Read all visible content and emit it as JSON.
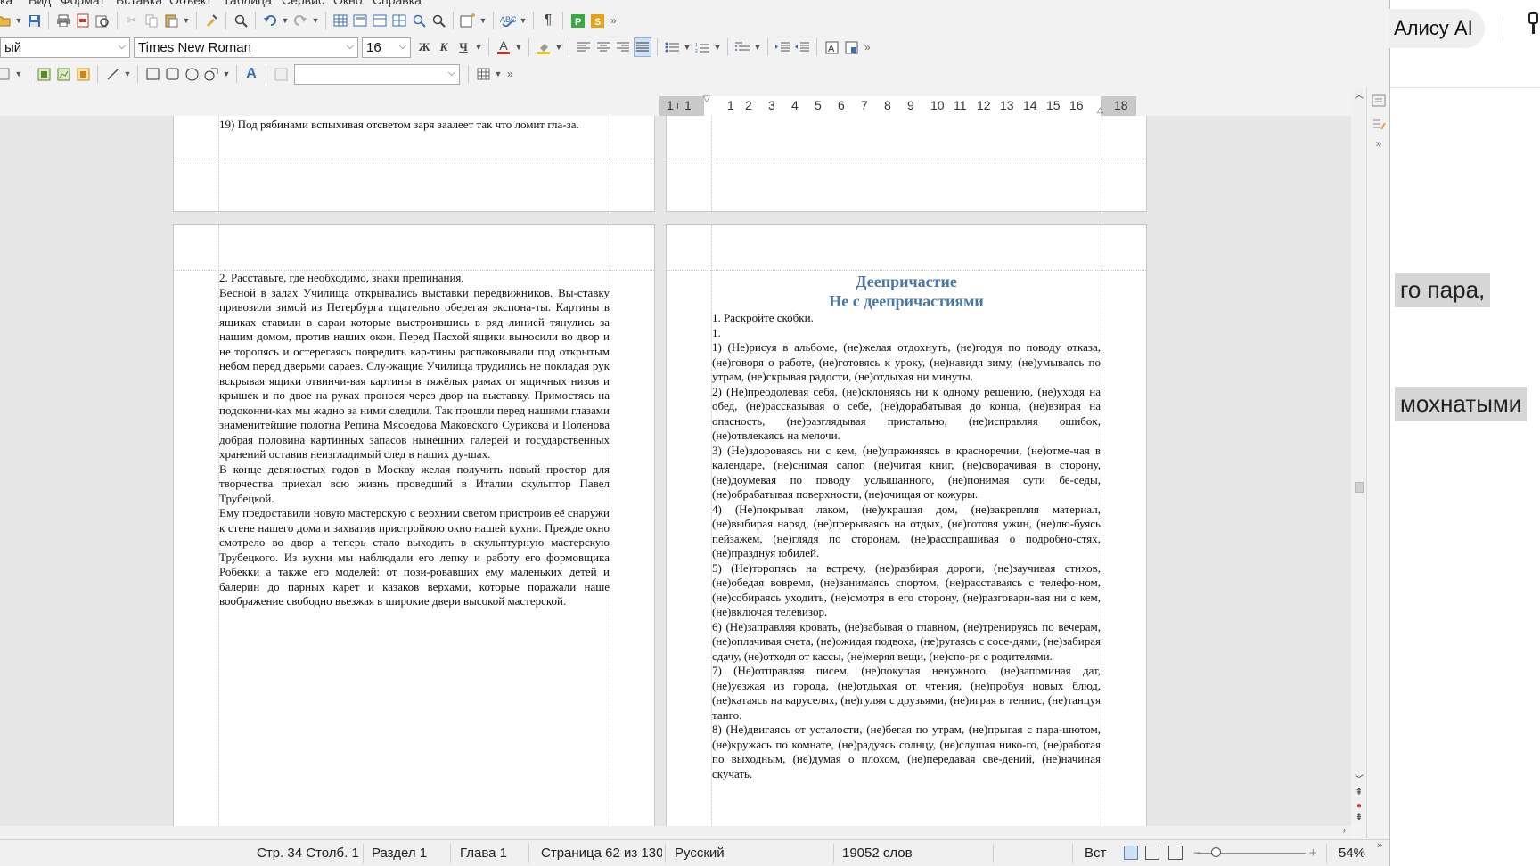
{
  "menu": [
    "ка",
    "Вид",
    "Формат",
    "Вставка",
    "Объект",
    "Таблица",
    "Сервис",
    "Окно",
    "Справка"
  ],
  "toolbar2": {
    "paragraph_style": "ый",
    "font_name": "Times New Roman",
    "font_size": "16",
    "bold_label": "Ж",
    "italic_label": "К",
    "underline_label": "Ч",
    "font_color_label": "A"
  },
  "ruler": {
    "numbers": [
      "1",
      "1",
      "1",
      "2",
      "3",
      "4",
      "5",
      "6",
      "7",
      "8",
      "9",
      "10",
      "11",
      "12",
      "13",
      "14",
      "15",
      "16",
      "18"
    ]
  },
  "pages": {
    "top_left_text": "19) Под рябинами вспыхивая отсветом заря заалеет так что ломит гла-за.",
    "left_paragraphs": [
      "2. Расставьте, где необходимо, знаки препинания.",
      "Весной в залах Училища открывались выставки передвижников. Вы-ставку привозили зимой из Петербурга тщательно оберегая экспона-ты. Картины в ящиках ставили в сараи которые выстроившись в ряд линией тянулись за нашим домом, против наших окон. Перед Пасхой ящики выносили во двор и не торопясь и остерегаясь повредить кар-тины распаковывали под открытым небом перед дверьми сараев. Слу-жащие Училища трудились не покладая рук вскрывая ящики отвинчи-вая картины в тяжёлых рамах от ящичных низов и крышек и по двое на руках пронося через двор на выставку. Примостясь на подоконни-ках мы жадно за ними следили. Так прошли перед нашими глазами знаменитейшие полотна Репина Мясоедова Маковского Сурикова и Поленова добрая половина картинных запасов нынешних галерей и государственных хранений оставив неизгладимый след в наших ду-шах.",
      "В конце девяностых годов в Москву желая получить новый простор для творчества приехал всю жизнь проведший в Италии скульптор Павел Трубецкой.",
      "Ему предоставили новую мастерскую с верхним светом пристроив её снаружи к стене нашего дома и захватив пристройкою окно нашей кухни. Прежде окно смотрело во двор а теперь стало выходить в скульптурную мастерскую Трубецкого. Из кухни мы наблюдали его лепку и работу его формовщика Робекки а также его моделей: от пози-ровавших ему маленьких детей и балерин до парных карет и казаков верхами, которые поражали наше воображение свободно въезжая в широкие двери высокой мастерской."
    ],
    "right_heading_1": "Деепричастие",
    "right_heading_2": "Не с деепричастиями",
    "right_paragraphs": [
      "1. Раскройте скобки.",
      "1.",
      "1) (Не)рисуя в альбоме, (не)желая отдохнуть, (не)годуя по поводу отказа, (не)говоря о работе, (не)готовясь к уроку, (не)навидя зиму, (не)умываясь по утрам, (не)скрывая радости, (не)отдыхая ни минуты.",
      "2) (Не)преодолевая себя, (не)склоняясь ни к одному решению, (не)уходя на обед, (не)рассказывая о себе, (не)дорабатывая до конца, (не)взирая на опасность, (не)разглядывая пристально, (не)исправляя ошибок, (не)отвлекаясь на мелочи.",
      "3) (Не)здороваясь ни с кем, (не)упражняясь в красноречии, (не)отме-чая в календаре, (не)снимая сапог, (не)читая книг, (не)сворачивая в сторону, (не)доумевая по поводу услышанного, (не)понимая сути бе-седы, (не)обрабатывая поверхности, (не)очищая от кожуры.",
      "4) (Не)покрывая лаком, (не)украшая дом, (не)закрепляя материал, (не)выбирая наряд, (не)прерываясь на отдых, (не)готовя ужин, (не)лю-буясь пейзажем, (не)глядя по сторонам, (не)расспрашивая о подробно-стях, (не)празднуя юбилей.",
      "5) (Не)торопясь на встречу, (не)разбирая дороги, (не)заучивая стихов, (не)обедая вовремя, (не)занимаясь спортом, (не)расставаясь с телефо-ном, (не)собираясь уходить, (не)смотря в его сторону, (не)разговари-вая ни с кем, (не)включая телевизор.",
      "6) (Не)заправляя кровать, (не)забывая о главном, (не)тренируясь по вечерам, (не)оплачивая счета, (не)ожидая подвоха, (не)ругаясь с сосе-дями, (не)забирая сдачу, (не)отходя от кассы, (не)меряя вещи, (не)спо-ря с родителями.",
      "7) (Не)отправляя писем, (не)покупая ненужного, (не)запоминая дат, (не)уезжая из города, (не)отдыхая от чтения, (не)пробуя новых блюд, (не)катаясь на каруселях, (не)гуляя с друзьями, (не)играя в теннис, (не)танцуя танго.",
      "8) (Не)двигаясь от усталости, (не)бегая по утрам, (не)прыгая с пара-шютом, (не)кружась по комнате, (не)радуясь солнцу, (не)слушая нико-го, (не)работая по выходным, (не)думая о плохом, (не)передавая све-дений, (не)начиная скучать."
    ]
  },
  "status": {
    "position": "Стр. 34 Столб. 1",
    "section": "Раздел 1",
    "chapter": "Глава 1",
    "page": "Страница 62 из 130",
    "language": "Русский",
    "words": "19052 слов",
    "insert_mode": "Вст",
    "zoom": "54%",
    "zoom_minus": "−",
    "zoom_plus": "+"
  },
  "browser": {
    "alisa_button": "Алису AI",
    "highlight_1": "го пара,",
    "highlight_2": "мохнатыми"
  },
  "icons": [
    "open-icon",
    "save-icon",
    "print-icon",
    "pdf-icon",
    "preview-icon",
    "cut-icon",
    "copy-icon",
    "paste-icon",
    "clone-format-icon",
    "find-icon",
    "undo-icon",
    "redo-icon",
    "table-icon",
    "chart-icon",
    "special-char-icon",
    "spellcheck-icon",
    "formatting-marks-icon",
    "bullets-icon",
    "numbering-icon",
    "align-icons",
    "shapes-icon",
    "fontwork-icon",
    "gear-icon"
  ],
  "colors": {
    "heading": "#4a78a4",
    "font_color": "#c0392b",
    "highlight": "#f1c40f",
    "accent_active": "#cfe0f5"
  }
}
